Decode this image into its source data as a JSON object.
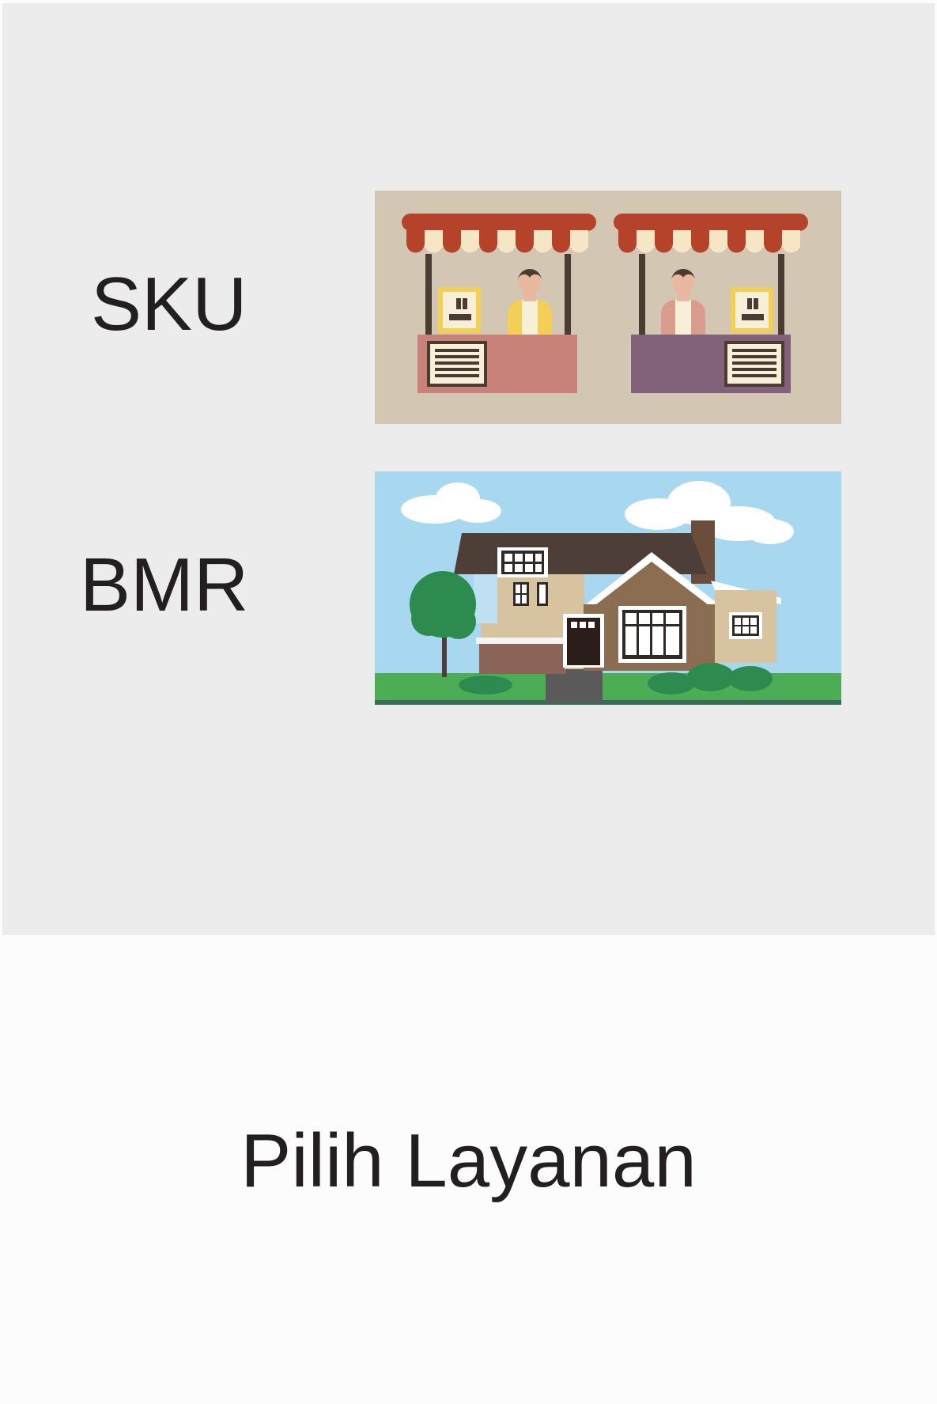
{
  "services": [
    {
      "label": "SKU",
      "icon": "market-stalls-icon"
    },
    {
      "label": "BMR",
      "icon": "house-icon"
    }
  ],
  "footer": {
    "title": "Pilih Layanan"
  },
  "colors": {
    "panel_bg": "#ececec",
    "page_bg": "#fcfcfc",
    "text": "#231f20",
    "stall_bg": "#d3c6b2",
    "awning_red": "#b5432a",
    "sky": "#a7d8ef",
    "grass": "#4cad56"
  }
}
